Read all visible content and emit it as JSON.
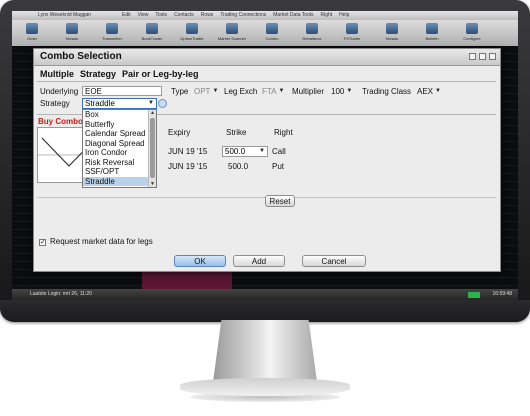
{
  "app": {
    "title": "Lynx Weseknid Maggan",
    "menu": [
      "Edit",
      "View",
      "Tools",
      "Contacts",
      "Rows",
      "Trading Connections",
      "Market Data Tools",
      "Right",
      "Help"
    ],
    "toolbar": [
      "Order",
      "Mosaic",
      "Transmitter",
      "BookTrader",
      "OptionTrader",
      "Market Scanner",
      "Combo",
      "Rebalance",
      "FXTrader",
      "Mosaic",
      "Bulletin",
      "Configure"
    ]
  },
  "status": {
    "left": "Laatste Login: mrt 26, 11:20",
    "right": "16:59:48"
  },
  "dialog": {
    "title": "Combo Selection",
    "tabs": [
      "Multiple",
      "Strategy",
      "Pair or Leg-by-leg"
    ],
    "underlying_label": "Underlying",
    "underlying_value": "EOE",
    "type_label": "Type",
    "type_value": "OPT",
    "leg_exch_label": "Leg Exch",
    "leg_exch_value": "FTA",
    "multiplier_label": "Multiplier",
    "multiplier_value": "100",
    "trading_class_label": "Trading Class",
    "trading_class_value": "AEX",
    "strategy_label": "Strategy",
    "strategy_value": "Straddle",
    "strategy_options": [
      "Box",
      "Butterfly",
      "Calendar Spread",
      "Diagonal Spread",
      "Iron Condor",
      "Risk Reversal",
      "SSF/OPT",
      "Straddle"
    ],
    "buy_combo": "Buy Combo",
    "legs_headers": {
      "expiry": "Expiry",
      "strike": "Strike",
      "right": "Right"
    },
    "legs": [
      {
        "expiry": "JUN 19 '15",
        "strike": "500.0",
        "right": "Call"
      },
      {
        "expiry": "JUN 19 '15",
        "strike": "500.0",
        "right": "Put"
      }
    ],
    "reset_label": "Reset",
    "request_market_data_label": "Request market data for legs",
    "request_market_data_checked": true,
    "ok_label": "OK",
    "add_label": "Add",
    "cancel_label": "Cancel"
  },
  "colors": {
    "buy_combo": "#c0211f",
    "selected_item": "#b9d1ea",
    "primary_button": "#98bfe9"
  }
}
